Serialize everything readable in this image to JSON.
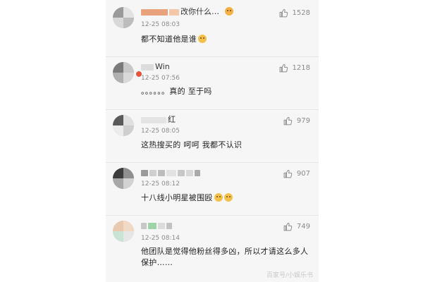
{
  "comments": [
    {
      "username_visible": "改你什么…",
      "time": "12-25 08:03",
      "text": "都不知道他是谁",
      "likes": "1528"
    },
    {
      "username_visible": "Win",
      "time": "12-25 07:56",
      "text": "。。。。。。真的 至于吗",
      "likes": "1218"
    },
    {
      "username_visible": "红",
      "time": "12-25 08:05",
      "text": "这热搜买的 呵呵 我都不认识",
      "likes": "979"
    },
    {
      "username_visible": "",
      "time": "12-25 08:12",
      "text": "十八线小明星被围殴",
      "likes": "907"
    },
    {
      "username_visible": "",
      "time": "12-25 08:14",
      "text": "他团队是觉得他粉丝得多凶，所以才请这么多人保护……",
      "likes": "749"
    }
  ],
  "watermark": "百家号/小娱乐书",
  "colors": {
    "panel_bg": "#f6f6f6",
    "meta_text": "#8a8a8a",
    "body_text": "#222222",
    "emoji_yellow": "#f3c14b",
    "vip_badge": "#e9533c"
  },
  "icons": {
    "like": "thumbs-up-icon"
  }
}
